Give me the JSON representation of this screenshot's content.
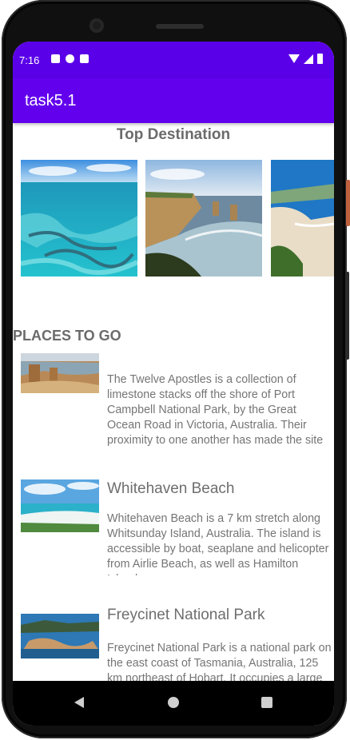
{
  "status_bar": {
    "time": "7:16",
    "left_icons": [
      "a-notification-icon",
      "circle-notification-icon",
      "sd-card-icon"
    ],
    "right_icons": [
      "wifi-icon",
      "signal-icon",
      "battery-icon"
    ]
  },
  "app_bar": {
    "title": "task5.1",
    "color": "#6200ee",
    "status_color": "#5a00e8"
  },
  "top_destination": {
    "title": "Top Destination",
    "images": [
      "great-barrier-reef-image",
      "twelve-apostles-cliffs-image",
      "bondi-beach-image"
    ]
  },
  "places": {
    "title": "PLACES TO GO",
    "items": [
      {
        "name": "",
        "image": "twelve-apostles-thumbnail",
        "description": "The Twelve Apostles is a collection of limestone stacks off the shore of Port Campbell National Park, by the Great Ocean Road in Victoria, Australia. Their proximity to one another has made the site a popular tourist attraction."
      },
      {
        "name": "Whitehaven Beach",
        "image": "whitehaven-beach-thumbnail",
        "description": "Whitehaven Beach is a 7 km stretch along Whitsunday Island, Australia. The island is accessible by boat, seaplane and helicopter from Airlie Beach, as well as Hamilton Island."
      },
      {
        "name": "Freycinet National Park",
        "image": "freycinet-thumbnail",
        "description": "Freycinet National Park is a national park on the east coast of Tasmania, Australia, 125 km northeast of Hobart. It occupies a large part of the Freycinet Peninsula."
      }
    ]
  },
  "nav_bar": {
    "icons": [
      "back-icon",
      "home-icon",
      "recents-icon"
    ]
  }
}
